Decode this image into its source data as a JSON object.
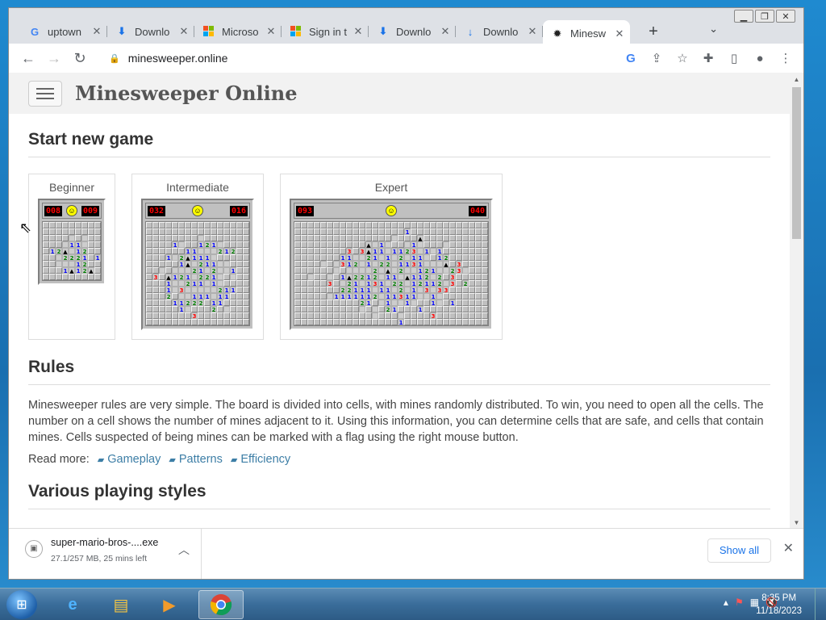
{
  "browser": {
    "tabs": [
      {
        "label": "uptown",
        "icon": "google-icon",
        "active": false
      },
      {
        "label": "Downlo",
        "icon": "download-tab-icon",
        "active": false
      },
      {
        "label": "Microso",
        "icon": "microsoft-icon",
        "active": false
      },
      {
        "label": "Sign in t",
        "icon": "microsoft-icon",
        "active": false
      },
      {
        "label": "Downlo",
        "icon": "download-tab-icon",
        "active": false
      },
      {
        "label": "Downlo",
        "icon": "download-arrow-icon",
        "active": false
      },
      {
        "label": "Minesw",
        "icon": "minesweeper-icon",
        "active": true
      }
    ],
    "url": "minesweeper.online"
  },
  "page": {
    "site_title": "Minesweeper Online",
    "start_heading": "Start new game",
    "games": [
      {
        "label": "Beginner",
        "mines": "008",
        "time": "009"
      },
      {
        "label": "Intermediate",
        "mines": "032",
        "time": "016"
      },
      {
        "label": "Expert",
        "mines": "093",
        "time": "040"
      }
    ],
    "rules_heading": "Rules",
    "rules_text": "Minesweeper rules are very simple. The board is divided into cells, with mines randomly distributed. To win, you need to open all the cells. The number on a cell shows the number of mines adjacent to it. Using this information, you can determine cells that are safe, and cells that contain mines. Cells suspected of being mines can be marked with a flag using the right mouse button.",
    "read_more_label": "Read more:",
    "read_more_links": [
      "Gameplay",
      "Patterns",
      "Efficiency"
    ],
    "styles_heading": "Various playing styles"
  },
  "download": {
    "filename": "super-mario-bros-....exe",
    "status": "27.1/257 MB, 25 mins left",
    "show_all": "Show all"
  },
  "taskbar": {
    "time": "8:35 PM",
    "date": "11/18/2023"
  }
}
